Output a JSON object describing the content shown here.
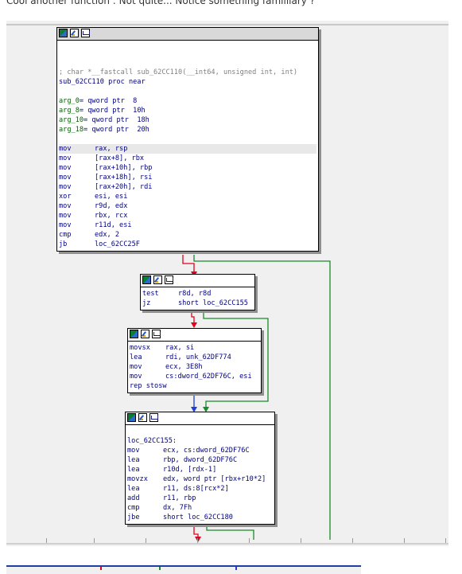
{
  "caption": "Cool another function : Not quite... Notice something familliary ?",
  "nodes": [
    {
      "id": "node-1",
      "header": [
        {
          "text": "; char *__fastcall sub_62CC110(__int64, unsigned int, int)",
          "kind": "comment"
        },
        {
          "text": "sub_62CC110 proc near",
          "kind": "label"
        },
        {
          "text": "",
          "kind": "blank"
        },
        {
          "var": "arg_0",
          "value": "qword ptr  8"
        },
        {
          "var": "arg_8",
          "value": "qword ptr  10h"
        },
        {
          "var": "arg_10",
          "value": "qword ptr  18h"
        },
        {
          "var": "arg_18",
          "value": "qword ptr  20h"
        },
        {
          "text": "",
          "kind": "blank"
        }
      ],
      "lines": [
        {
          "mn": "mov",
          "ops": "rax, rsp",
          "highlight": true
        },
        {
          "mn": "mov",
          "ops": "[rax+8], rbx"
        },
        {
          "mn": "mov",
          "ops": "[rax+10h], rbp"
        },
        {
          "mn": "mov",
          "ops": "[rax+18h], rsi"
        },
        {
          "mn": "mov",
          "ops": "[rax+20h], rdi"
        },
        {
          "mn": "xor",
          "ops": "esi, esi"
        },
        {
          "mn": "mov",
          "ops": "r9d, edx"
        },
        {
          "mn": "mov",
          "ops": "rbx, rcx"
        },
        {
          "mn": "mov",
          "ops": "r11d, esi"
        },
        {
          "mn": "cmp",
          "ops": "edx, 2"
        },
        {
          "mn": "jb",
          "ops": "loc_62CC25F"
        }
      ]
    },
    {
      "id": "node-2",
      "header": [],
      "lines": [
        {
          "mn": "test",
          "ops": "r8d, r8d"
        },
        {
          "mn": "jz",
          "ops": "short loc_62CC155"
        }
      ]
    },
    {
      "id": "node-3",
      "header": [],
      "lines": [
        {
          "mn": "movsx",
          "ops": "rax, si"
        },
        {
          "mn": "lea",
          "ops": "rdi, unk_62DF774"
        },
        {
          "mn": "mov",
          "ops": "ecx, 3E8h"
        },
        {
          "mn": "mov",
          "ops": "cs:dword_62DF76C, esi"
        },
        {
          "mn": "rep stosw",
          "ops": ""
        }
      ]
    },
    {
      "id": "node-4",
      "header": [
        {
          "text": "",
          "kind": "blank"
        },
        {
          "text": "loc_62CC155:",
          "kind": "label"
        }
      ],
      "lines": [
        {
          "mn": "mov",
          "ops": "ecx, cs:dword_62DF76C"
        },
        {
          "mn": "lea",
          "ops": "rbp, dword_62DF76C"
        },
        {
          "mn": "lea",
          "ops": "r10d, [rdx-1]"
        },
        {
          "mn": "movzx",
          "ops": "edx, word ptr [rbx+r10*2]"
        },
        {
          "mn": "lea",
          "ops": "r11, ds:8[rcx*2]"
        },
        {
          "mn": "add",
          "ops": "r11, rbp"
        },
        {
          "mn": "cmp",
          "ops": "dx, 7Fh"
        },
        {
          "mn": "jbe",
          "ops": "short loc_62CC180"
        }
      ]
    }
  ],
  "toolbar_icons": [
    "graph-color-icon",
    "edit-node-icon",
    "xrefs-icon"
  ],
  "colors": {
    "edge_true": "#2ca02c",
    "edge_false": "#e3001b",
    "edge_unconditional": "#1f3fd6",
    "edge_green": "#1a8a2a"
  }
}
